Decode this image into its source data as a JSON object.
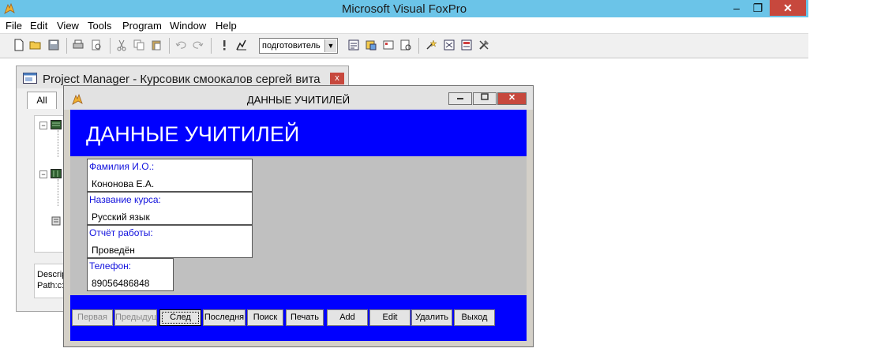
{
  "app": {
    "title": "Microsoft Visual FoxPro",
    "window_controls": {
      "minimize": "–",
      "restore": "❐",
      "close": "✕"
    }
  },
  "menu": {
    "items": [
      {
        "label": "File"
      },
      {
        "label": "Edit"
      },
      {
        "label": "View"
      },
      {
        "label": "Tools"
      },
      {
        "label": "Program"
      },
      {
        "label": "Window"
      },
      {
        "label": "Help"
      }
    ]
  },
  "toolbar": {
    "combo_value": "подготовитель"
  },
  "project_manager": {
    "title": "Project Manager - Курсовик смоокалов сергей вита",
    "close": "x",
    "tab_all": "All",
    "desc_label": "Descrip",
    "path_label": "Path:c:"
  },
  "form": {
    "window_title": "ДАННЫЕ УЧИТИЛЕЙ",
    "header_title": "ДАННЫЕ УЧИТИЛЕЙ",
    "close": "✕",
    "fields": [
      {
        "label": "Фамилия И.О.:",
        "value": "Кононова Е.А."
      },
      {
        "label": "Название курса:",
        "value": "Русский язык"
      },
      {
        "label": "Отчёт работы:",
        "value": "Проведён"
      },
      {
        "label": "Телефон:",
        "value": "89056486848"
      }
    ],
    "buttons": [
      {
        "label": "Первая",
        "enabled": false
      },
      {
        "label": "Предыдущ",
        "enabled": false
      },
      {
        "label": "След",
        "enabled": true
      },
      {
        "label": "Последня",
        "enabled": true
      },
      {
        "label": "Поиск",
        "enabled": true
      },
      {
        "label": "Печать",
        "enabled": true
      },
      {
        "label": "Add",
        "enabled": true
      },
      {
        "label": "Edit",
        "enabled": true
      },
      {
        "label": "Удалить",
        "enabled": true
      },
      {
        "label": "Выход",
        "enabled": true
      }
    ]
  }
}
